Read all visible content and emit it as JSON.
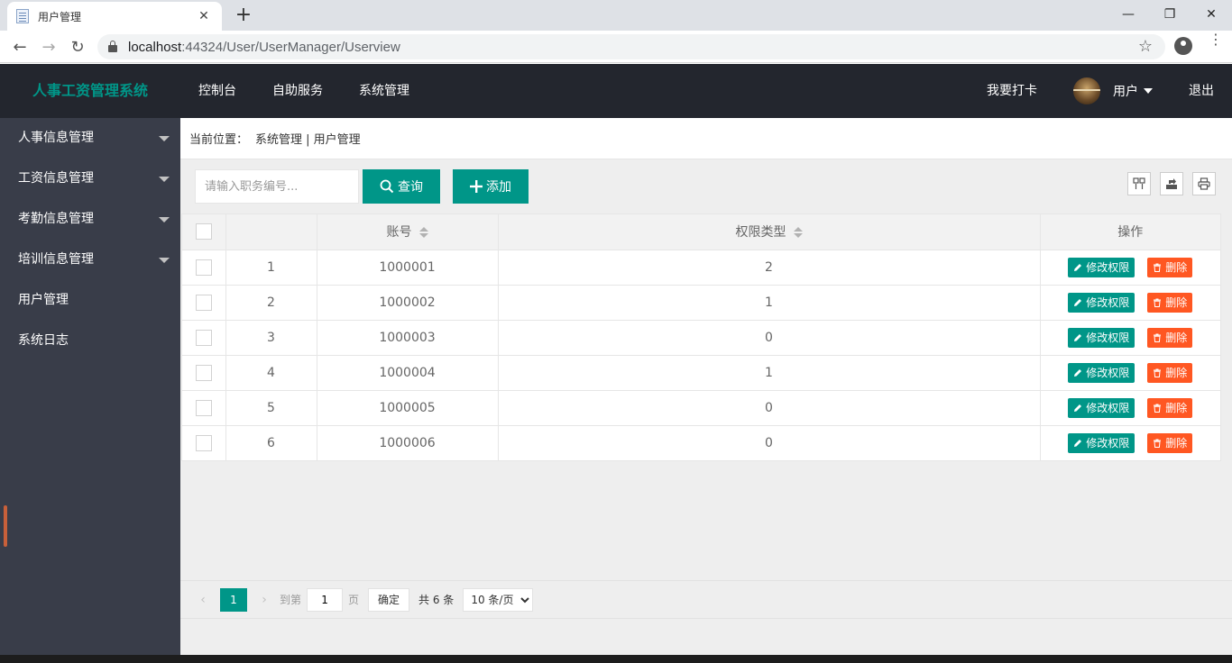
{
  "browser": {
    "tab_title": "用户管理",
    "tab_close": "✕",
    "new_tab": "+",
    "url_host": "localhost",
    "url_path": ":44324/User/UserManager/Userview",
    "minimize": "—",
    "maximize": "❐",
    "close": "✕",
    "back": "←",
    "forward": "→",
    "reload": "↻",
    "star": "☆",
    "menu": "⋮"
  },
  "header": {
    "logo": "人事工资管理系统",
    "nav": [
      "控制台",
      "自助服务",
      "系统管理"
    ],
    "clock_in": "我要打卡",
    "user": "用户",
    "logout": "退出"
  },
  "sidebar": {
    "items": [
      {
        "label": "人事信息管理",
        "has_arrow": true
      },
      {
        "label": "工资信息管理",
        "has_arrow": true
      },
      {
        "label": "考勤信息管理",
        "has_arrow": true
      },
      {
        "label": "培训信息管理",
        "has_arrow": true
      },
      {
        "label": "用户管理",
        "has_arrow": false
      },
      {
        "label": "系统日志",
        "has_arrow": false
      }
    ]
  },
  "breadcrumb": {
    "prefix": "当前位置：",
    "path": "系统管理 | 用户管理"
  },
  "toolbar": {
    "search_placeholder": "请输入职务编号...",
    "search_label": "查询",
    "add_label": "添加"
  },
  "table": {
    "headers": {
      "account": "账号",
      "permission": "权限类型",
      "operation": "操作"
    },
    "rows": [
      {
        "index": "1",
        "account": "1000001",
        "permission": "2"
      },
      {
        "index": "2",
        "account": "1000002",
        "permission": "1"
      },
      {
        "index": "3",
        "account": "1000003",
        "permission": "0"
      },
      {
        "index": "4",
        "account": "1000004",
        "permission": "1"
      },
      {
        "index": "5",
        "account": "1000005",
        "permission": "0"
      },
      {
        "index": "6",
        "account": "1000006",
        "permission": "0"
      }
    ],
    "edit_label": "修改权限",
    "delete_label": "删除"
  },
  "pager": {
    "current": "1",
    "goto_prefix": "到第",
    "goto_value": "1",
    "goto_suffix": "页",
    "confirm": "确定",
    "total": "共 6 条",
    "page_size": "10 条/页"
  },
  "colors": {
    "accent": "#009688",
    "danger": "#ff5722",
    "header_bg": "#23262e",
    "sidebar_bg": "#393d49"
  }
}
